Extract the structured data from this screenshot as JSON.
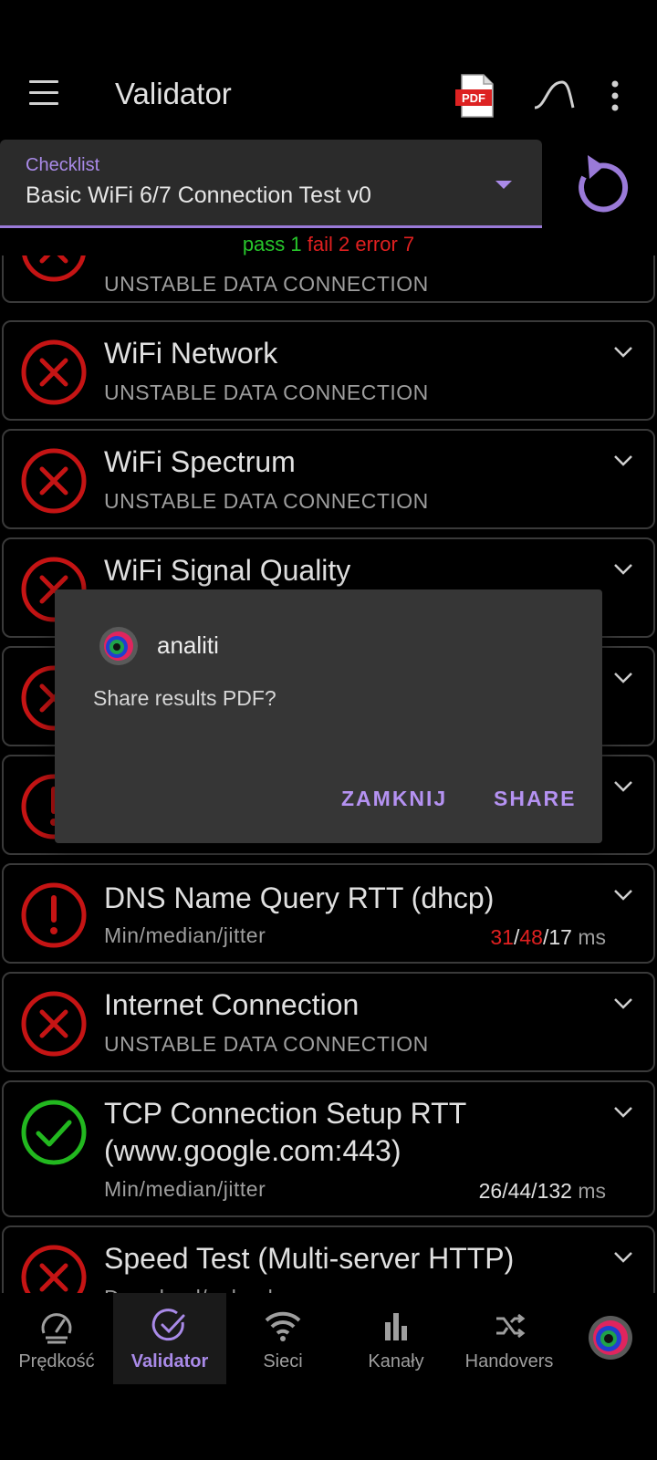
{
  "appbar": {
    "title": "Validator",
    "pdf_icon_text": "PDF"
  },
  "selector": {
    "caption": "Checklist",
    "value": "Basic WiFi 6/7 Connection Test v0"
  },
  "summary": {
    "pass": "pass 1",
    "fail": "fail 2",
    "error": "error 7"
  },
  "tests": [
    {
      "name": "",
      "sub": "UNSTABLE DATA CONNECTION",
      "status": "fail"
    },
    {
      "name": "WiFi Network",
      "sub": "UNSTABLE DATA CONNECTION",
      "status": "fail"
    },
    {
      "name": "WiFi Spectrum",
      "sub": "UNSTABLE DATA CONNECTION",
      "status": "fail"
    },
    {
      "name": "WiFi Signal Quality",
      "sub": "",
      "status": "fail"
    },
    {
      "name": "",
      "sub": "",
      "status": "fail"
    },
    {
      "name": "",
      "sub": "",
      "status": "error",
      "partial": "%"
    },
    {
      "name": "DNS Name Query RTT (dhcp)",
      "sub": "Min/median/jitter",
      "status": "error",
      "v1": "31",
      "s1": "/",
      "v2": "48",
      "s2": "/",
      "v3": "17",
      "unit": " ms"
    },
    {
      "name": "Internet Connection",
      "sub": "UNSTABLE DATA CONNECTION",
      "status": "fail"
    },
    {
      "name_line1": "TCP Connection Setup RTT",
      "name_line2": "(www.google.com:443)",
      "sub": "Min/median/jitter",
      "status": "pass",
      "v1": "26",
      "s1": "/",
      "v2": "44",
      "s2": "/",
      "v3": "132",
      "unit": " ms"
    },
    {
      "name": "Speed Test (Multi-server HTTP)",
      "sub": "Download/upload",
      "status": "fail"
    }
  ],
  "dialog": {
    "app": "analiti",
    "message": "Share results PDF?",
    "dismiss": "ZAMKNIJ",
    "confirm": "SHARE"
  },
  "nav": [
    {
      "label": "Prędkość",
      "icon": "speedometer-icon"
    },
    {
      "label": "Validator",
      "icon": "check-circle-icon",
      "active": true
    },
    {
      "label": "Sieci",
      "icon": "wifi-icon"
    },
    {
      "label": "Kanały",
      "icon": "bar-chart-icon"
    },
    {
      "label": "Handovers",
      "icon": "shuffle-icon"
    }
  ],
  "colors": {
    "accent": "#a98ae8",
    "pass": "#27c62b",
    "fail": "#e02020",
    "error": "#e02020",
    "surface": "#2b2b2b",
    "dialog": "#363636"
  }
}
